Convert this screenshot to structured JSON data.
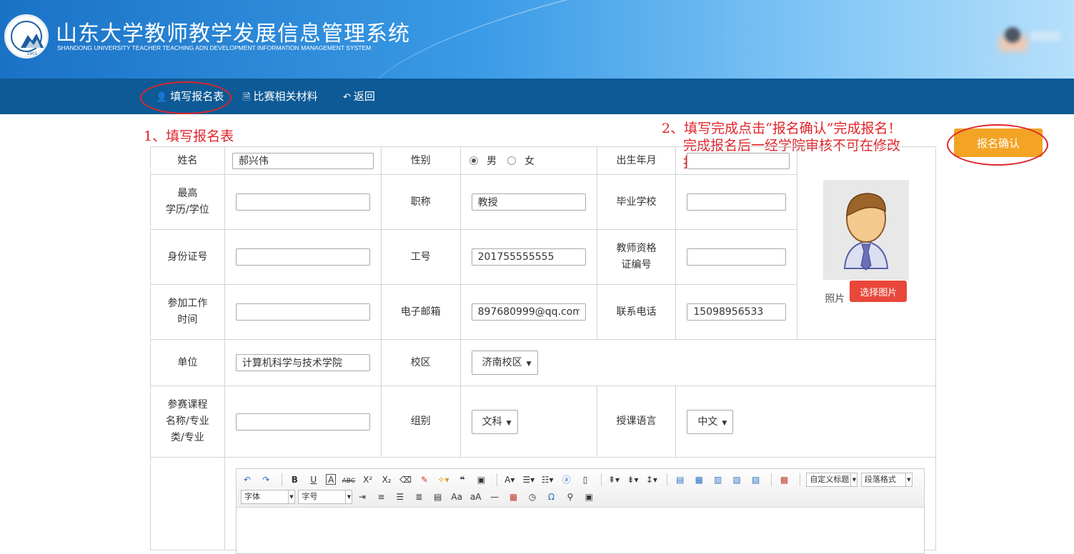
{
  "header": {
    "title": "山东大学教师教学发展信息管理系统",
    "subtitle": "SHANDONG UNIVERSITY TEACHER TEACHING ADN DEVELOPMENT INFORMATION MANAGEMENT SYSTEM",
    "logo_year": "1901"
  },
  "nav": {
    "items": [
      {
        "label": "填写报名表",
        "icon": "user-icon"
      },
      {
        "label": "比赛相关材料",
        "icon": "document-icon"
      },
      {
        "label": "返回",
        "icon": "reply-icon"
      }
    ]
  },
  "annotations": {
    "step1": "1、填写报名表",
    "step2_line1": "2、填写完成点击“报名确认”完成报名！",
    "step2_line2": "完成报名后一经学院审核不可在修改",
    "step2_line3": "报名表资料！"
  },
  "confirm_button": "报名确认",
  "form": {
    "name_label": "姓名",
    "name_value": "郝兴伟",
    "gender_label": "性别",
    "gender_male": "男",
    "gender_female": "女",
    "gender_selected": "男",
    "birth_label": "出生年月",
    "birth_value": "",
    "degree_label_1": "最高",
    "degree_label_2": "学历/学位",
    "degree_value": "",
    "title_label": "职称",
    "title_value": "教授",
    "school_label": "毕业学校",
    "school_value": "",
    "id_label": "身份证号",
    "id_value": "",
    "staffno_label": "工号",
    "staffno_value": "201755555555",
    "cert_label_1": "教师资格",
    "cert_label_2": "证编号",
    "cert_value": "",
    "work_label_1": "参加工作",
    "work_label_2": "时间",
    "work_value": "",
    "email_label": "电子邮箱",
    "email_value": "897680999@qq.com",
    "phone_label": "联系电话",
    "phone_value": "15098956533",
    "unit_label": "单位",
    "unit_value": "计算机科学与技术学院",
    "campus_label": "校区",
    "campus_value": "济南校区",
    "course_label_1": "参赛课程",
    "course_label_2": "名称/专业",
    "course_label_3": "类/专业",
    "course_value": "",
    "group_label": "组别",
    "group_value": "文科",
    "lang_label": "授课语言",
    "lang_value": "中文",
    "photo_label": "照片",
    "photo_button": "选择图片"
  },
  "editor": {
    "custom_title": "自定义标题",
    "paragraph": "段落格式",
    "font": "字体",
    "size": "字号"
  }
}
